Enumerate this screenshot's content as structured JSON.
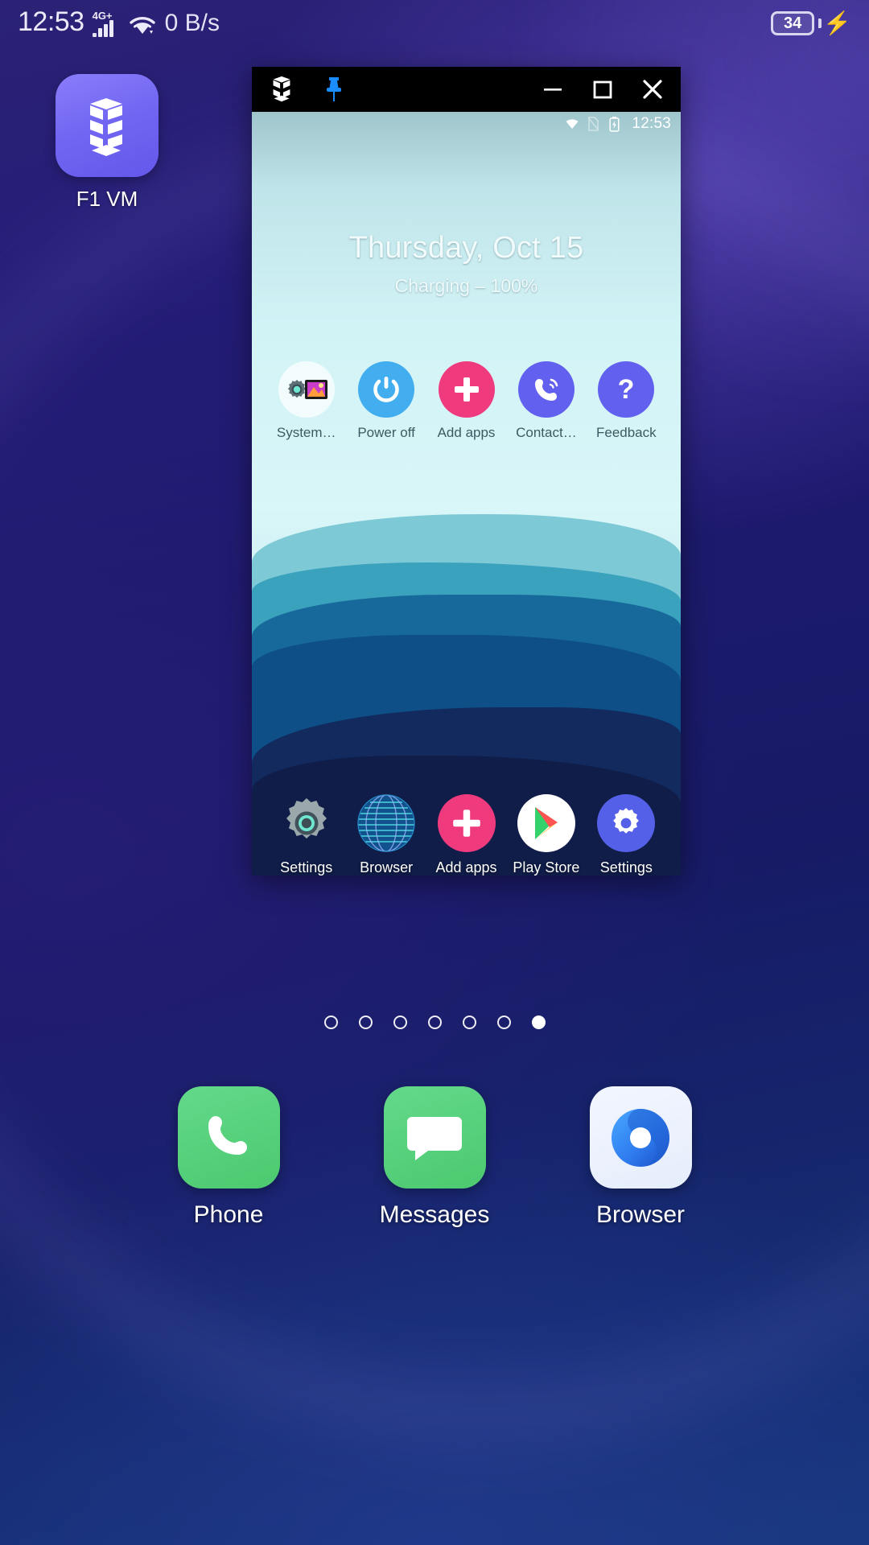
{
  "status_bar": {
    "clock": "12:53",
    "network_type": "4G+",
    "signal_icon": "signal-bars-icon",
    "wifi_icon": "wifi-icon",
    "data_rate": "0 B/s",
    "battery_level": "34",
    "battery_icon": "battery-icon",
    "charging_icon": "charging-bolt-icon"
  },
  "desktop_icon": {
    "label": "F1 VM",
    "icon": "cube-logo-icon",
    "tile_color": "#7166f2"
  },
  "vm_window": {
    "titlebar": {
      "app_icon": "cube-logo-icon",
      "pin_icon": "pin-icon",
      "pin_color": "#1a8cff",
      "minimize_label": "minimize-icon",
      "maximize_label": "maximize-icon",
      "close_label": "close-icon"
    },
    "screen": {
      "status": {
        "wifi_icon": "wifi-icon",
        "sim_icon": "no-sim-icon",
        "battery_icon": "battery-charging-icon",
        "clock": "12:53"
      },
      "widget": {
        "date": "Thursday, Oct 15",
        "battery_status": "Charging – 100%"
      },
      "home_icons": [
        {
          "label": "System…",
          "icon": "system-folder-icon",
          "style": "c-folder"
        },
        {
          "label": "Power off",
          "icon": "power-icon",
          "style": "c-blue"
        },
        {
          "label": "Add apps",
          "icon": "plus-icon",
          "style": "c-pink"
        },
        {
          "label": "Contact…",
          "icon": "phone-call-icon",
          "style": "c-purple"
        },
        {
          "label": "Feedback",
          "icon": "question-mark-icon",
          "style": "c-purple"
        }
      ],
      "dock_icons": [
        {
          "label": "Settings",
          "icon": "gear-icon",
          "style": "c-gear-d"
        },
        {
          "label": "Browser",
          "icon": "globe-icon",
          "style": "c-blue"
        },
        {
          "label": "Add apps",
          "icon": "plus-icon",
          "style": "c-pink"
        },
        {
          "label": "Play Store",
          "icon": "play-store-icon",
          "style": "c-white"
        },
        {
          "label": "Settings",
          "icon": "gear-icon",
          "style": "c-blue-d"
        }
      ]
    }
  },
  "page_indicator": {
    "total": 7,
    "active_index": 6
  },
  "dock": [
    {
      "label": "Phone",
      "icon": "phone-icon",
      "tile": "t-phone"
    },
    {
      "label": "Messages",
      "icon": "message-icon",
      "tile": "t-msg"
    },
    {
      "label": "Browser",
      "icon": "browser-icon",
      "tile": "t-brow"
    }
  ]
}
